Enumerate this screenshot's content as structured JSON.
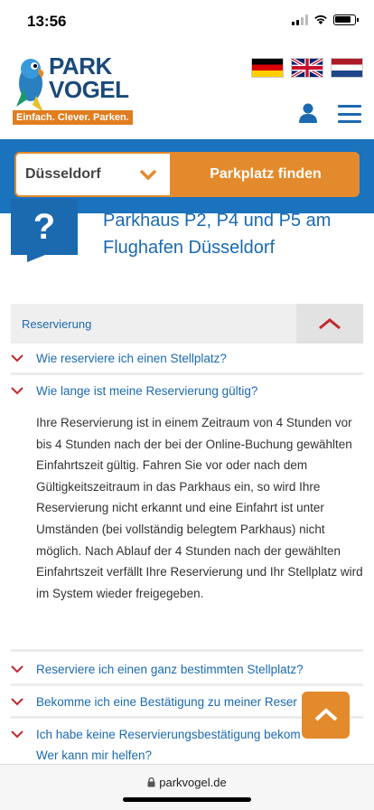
{
  "status": {
    "time": "13:56"
  },
  "header": {
    "logo_text_1": "PARK",
    "logo_text_2": "VOGEL",
    "logo_tagline": "Einfach. Clever. Parken."
  },
  "search": {
    "city": "Düsseldorf",
    "button": "Parkplatz finden"
  },
  "page": {
    "icon_glyph": "?",
    "title": "Parkhaus P2, P4 und P5 am Flughafen Düsseldorf"
  },
  "faq": {
    "section_label": "Reservierung",
    "items": [
      {
        "question": "Wie reserviere ich einen Stellplatz?"
      },
      {
        "question": "Wie lange ist meine Reservierung gültig?"
      },
      {
        "question": "Reserviere ich einen ganz bestimmten Stellplatz?"
      },
      {
        "question": "Bekomme ich eine Bestätigung zu meiner Reser"
      },
      {
        "question": "Ich habe keine Reservierungsbestätigung bekom"
      },
      {
        "question": "Wer kann mir helfen?"
      }
    ],
    "answer": "Ihre Reservierung ist in einem Zeitraum von 4 Stunden vor bis 4 Stunden nach der bei der Online-Buchung gewählten Einfahrtszeit gültig. Fahren Sie vor oder nach dem Gültigkeitszeitraum in das Parkhaus ein, so wird Ihre Reservierung nicht erkannt und eine Einfahrt ist unter Umständen (bei vollständig belegtem Parkhaus) nicht möglich. Nach Ablauf der 4 Stunden nach der gewählten Einfahrtszeit verfällt Ihre Reservierung und Ihr Stellplatz wird im System wieder freigegeben."
  },
  "browser": {
    "url": "parkvogel.de"
  },
  "colors": {
    "brand_blue": "#1b6ab0",
    "accent_orange": "#e38a2c",
    "chevron_red": "#c0282e"
  },
  "icons": [
    "signal-icon",
    "wifi-icon",
    "battery-icon",
    "parrot-logo",
    "flag-de-icon",
    "flag-uk-icon",
    "flag-nl-icon",
    "user-icon",
    "menu-icon",
    "chevron-down-icon",
    "chevron-up-icon",
    "lock-icon"
  ]
}
